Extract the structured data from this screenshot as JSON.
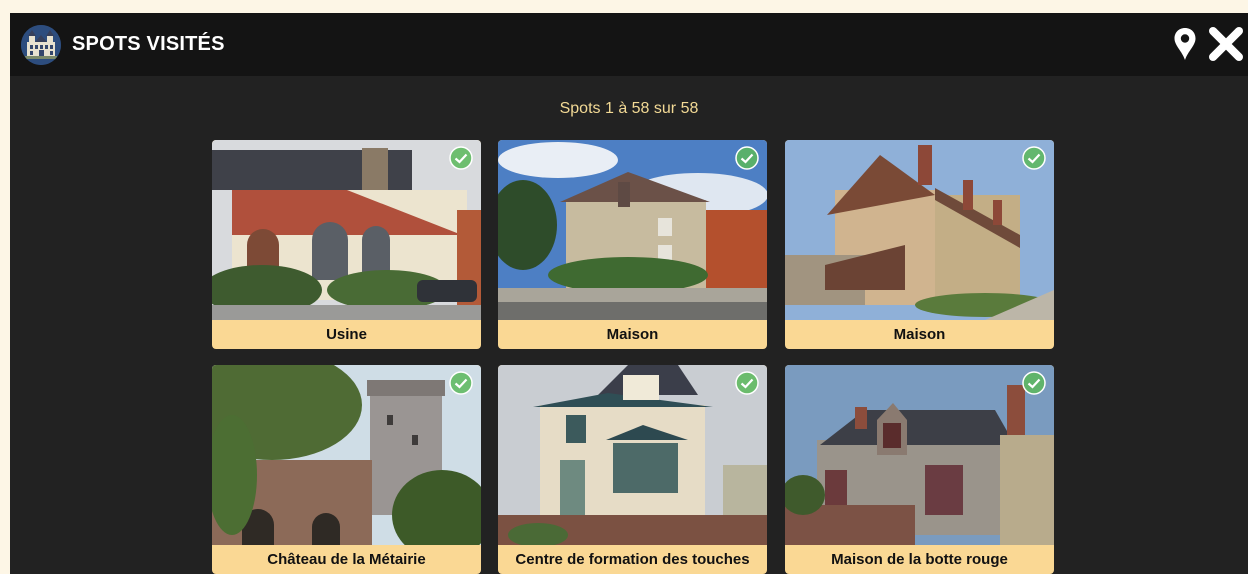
{
  "header": {
    "title": "SPOTS VISITÉS",
    "logo": "chateau-logo",
    "map_icon": "map-pin-icon",
    "close_icon": "close-icon"
  },
  "count_text": "Spots 1 à 58 sur 58",
  "colors": {
    "header_bg": "#141414",
    "panel_bg": "#222222",
    "accent": "#fad894",
    "check": "#5cb85c"
  },
  "spots": [
    {
      "label": "Usine",
      "visited": true
    },
    {
      "label": "Maison",
      "visited": true
    },
    {
      "label": "Maison",
      "visited": true
    },
    {
      "label": "Château de la Métairie",
      "visited": true
    },
    {
      "label": "Centre de formation des touches",
      "visited": true
    },
    {
      "label": "Maison de la botte rouge",
      "visited": true
    }
  ]
}
